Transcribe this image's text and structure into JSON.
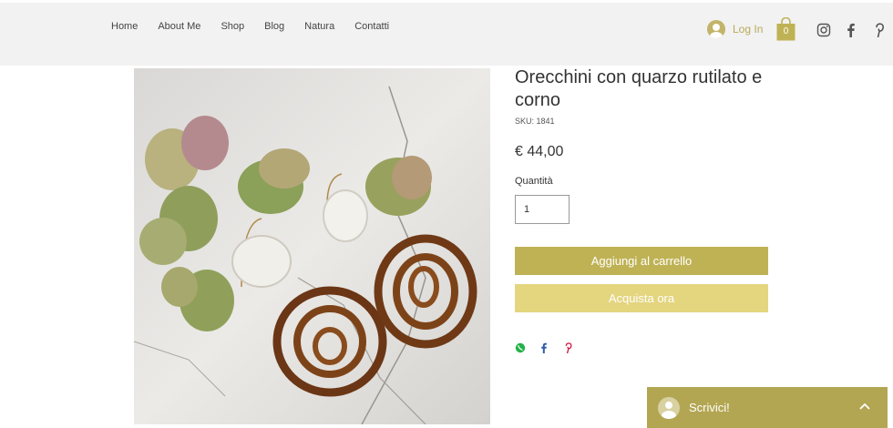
{
  "nav": {
    "items": [
      "Home",
      "About Me",
      "Shop",
      "Blog",
      "Natura",
      "Contatti"
    ]
  },
  "header": {
    "login_label": "Log In",
    "cart_count": "0",
    "accent": "#bfb255"
  },
  "social": {
    "icons": [
      "instagram-icon",
      "facebook-icon",
      "pinterest-icon"
    ]
  },
  "product": {
    "title": "Orecchini con quarzo rutilato e corno",
    "sku": "SKU: 1841",
    "price": "€ 44,00",
    "quantity_label": "Quantità",
    "quantity_value": "1",
    "add_to_cart": "Aggiungi al carrello",
    "buy_now": "Acquista ora"
  },
  "share": {
    "icons": [
      "whatsapp-icon",
      "facebook-icon",
      "pinterest-icon"
    ]
  },
  "chat": {
    "label": "Scrivici!"
  }
}
